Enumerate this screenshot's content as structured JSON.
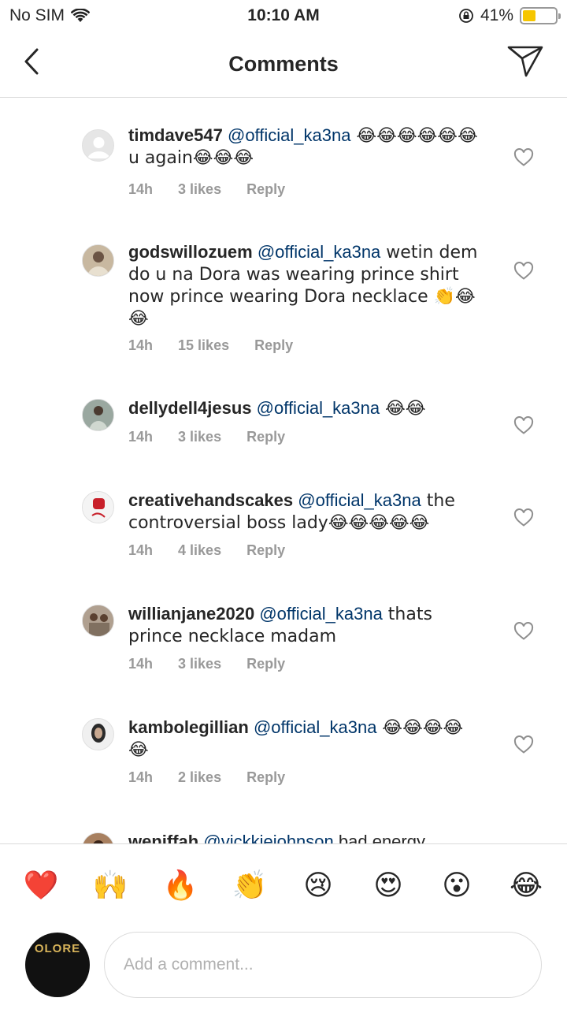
{
  "status_bar": {
    "carrier": "No SIM",
    "time": "10:10 AM",
    "battery_text": "41%",
    "battery_level": 0.41,
    "battery_color": "#f6c600"
  },
  "nav": {
    "title": "Comments",
    "back_icon": "chevron-left-icon",
    "share_icon": "send-icon"
  },
  "comments": [
    {
      "username": "timdave547",
      "mention": "@official_ka3na",
      "text": " 😂😂😂😂😂😂u again😂😂😂",
      "time": "14h",
      "likes": "3 likes",
      "reply": "Reply"
    },
    {
      "username": "godswillozuem",
      "mention": "@official_ka3na",
      "text": " wetin dem do u na Dora was wearing prince shirt now prince wearing Dora necklace 👏😂😂",
      "time": "14h",
      "likes": "15 likes",
      "reply": "Reply"
    },
    {
      "username": "dellydell4jesus",
      "mention": "@official_ka3na",
      "text": " 😂😂",
      "time": "14h",
      "likes": "3 likes",
      "reply": "Reply"
    },
    {
      "username": "creativehandscakes",
      "mention": "@official_ka3na",
      "text": " the controversial boss lady😂😂😂😂😂",
      "time": "14h",
      "likes": "4 likes",
      "reply": "Reply"
    },
    {
      "username": "willianjane2020",
      "mention": "@official_ka3na",
      "text": " thats prince necklace madam",
      "time": "14h",
      "likes": "3 likes",
      "reply": "Reply"
    },
    {
      "username": "kambolegillian",
      "mention": "@official_ka3na",
      "text": " 😂😂😂😂😂",
      "time": "14h",
      "likes": "2 likes",
      "reply": "Reply"
    },
    {
      "username": "weniffah",
      "mention": "@vickkiejohnson",
      "text": " bad energy",
      "time": "",
      "likes": "",
      "reply": ""
    }
  ],
  "quick_emojis": [
    "❤️",
    "🙌",
    "🔥",
    "👏",
    "😢",
    "😍",
    "😮",
    "😂"
  ],
  "compose": {
    "placeholder": "Add a comment...",
    "avatar_text": "OLORE"
  }
}
